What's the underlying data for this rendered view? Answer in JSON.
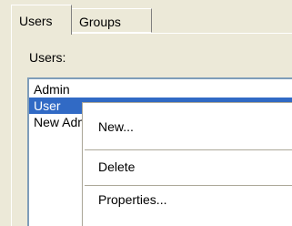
{
  "tabs": [
    {
      "label": "Users",
      "selected": true
    },
    {
      "label": "Groups",
      "selected": false
    }
  ],
  "users_label": "Users:",
  "users_list": [
    {
      "label": "Admin",
      "selected": false
    },
    {
      "label": "User",
      "selected": true
    },
    {
      "label": "New Administrator",
      "selected": false
    }
  ],
  "context_menu": {
    "new": "New...",
    "delete": "Delete",
    "properties": "Properties..."
  },
  "colors": {
    "face": "#ece9d8",
    "selection": "#316ac5",
    "list_border": "#7f9db9"
  }
}
